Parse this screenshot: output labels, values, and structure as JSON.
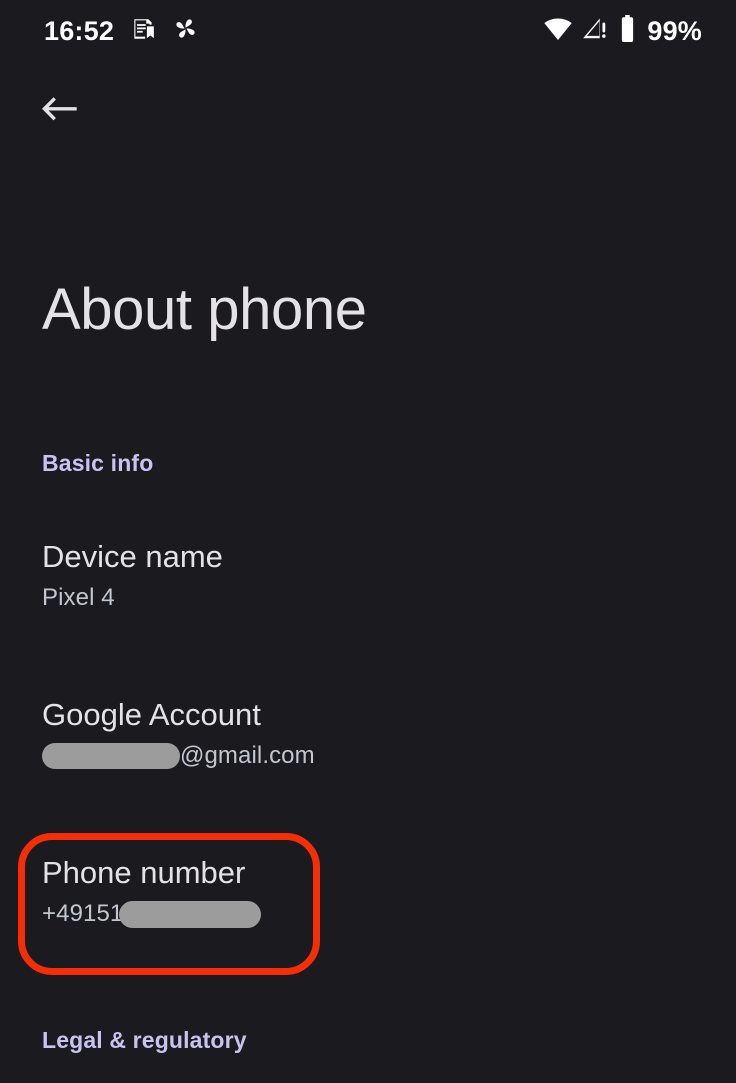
{
  "status_bar": {
    "time": "16:52",
    "left_icons": [
      {
        "name": "notes-icon",
        "glyph": "notes"
      },
      {
        "name": "pinwheel-icon",
        "glyph": "pinwheel"
      }
    ],
    "right_icons": [
      {
        "name": "wifi-icon",
        "glyph": "wifi"
      },
      {
        "name": "cellular-no-service-icon",
        "glyph": "signal-alert"
      },
      {
        "name": "battery-icon",
        "glyph": "battery-full"
      }
    ],
    "battery_percent": "99%"
  },
  "app_bar": {
    "back_label": "Back",
    "title": "About phone"
  },
  "sections": {
    "basic_info_label": "Basic info",
    "legal_label": "Legal & regulatory"
  },
  "rows": {
    "device_name": {
      "title": "Device name",
      "value": "Pixel 4"
    },
    "google_account": {
      "title": "Google Account",
      "value_suffix": "@gmail.com",
      "value_redacted": true
    },
    "phone_number": {
      "title": "Phone number",
      "value_prefix": "+49151",
      "value_redacted": true
    }
  },
  "annotation": {
    "target": "phone-number-row",
    "color": "#f62e08",
    "shape": "rounded-rectangle"
  },
  "colors": {
    "background": "#1b1b1f",
    "primary_text": "#e4e2e6",
    "secondary_text": "#c3c6cf",
    "section_accent": "#c8c3f0",
    "redaction": "#9c9c9c",
    "annotation_red": "#f62e08"
  }
}
